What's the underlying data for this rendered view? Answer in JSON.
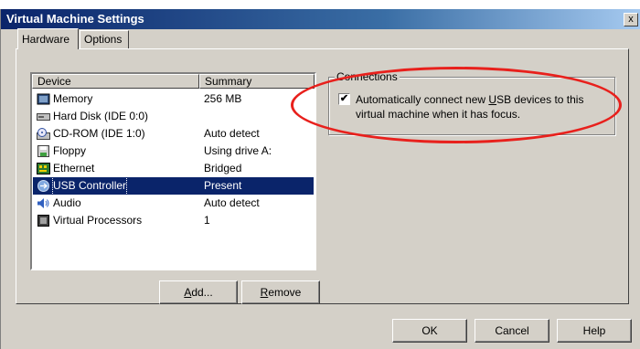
{
  "window": {
    "title": "Virtual Machine Settings",
    "close_glyph": "x"
  },
  "tabs": [
    {
      "label": "Hardware"
    },
    {
      "label": "Options"
    }
  ],
  "device_list": {
    "headers": {
      "device": "Device",
      "summary": "Summary"
    },
    "rows": [
      {
        "device": "Memory",
        "summary": "256 MB",
        "icon": "memory-icon"
      },
      {
        "device": "Hard Disk (IDE 0:0)",
        "summary": "",
        "icon": "hard-disk-icon"
      },
      {
        "device": "CD-ROM (IDE 1:0)",
        "summary": "Auto detect",
        "icon": "cdrom-icon"
      },
      {
        "device": "Floppy",
        "summary": "Using drive A:",
        "icon": "floppy-icon"
      },
      {
        "device": "Ethernet",
        "summary": "Bridged",
        "icon": "ethernet-icon"
      },
      {
        "device": "USB Controller",
        "summary": "Present",
        "icon": "usb-icon",
        "selected": true
      },
      {
        "device": "Audio",
        "summary": "Auto detect",
        "icon": "audio-icon"
      },
      {
        "device": "Virtual Processors",
        "summary": "1",
        "icon": "processor-icon"
      }
    ]
  },
  "buttons": {
    "add": {
      "prefix": "",
      "accel": "A",
      "suffix": "dd..."
    },
    "remove": {
      "prefix": "",
      "accel": "R",
      "suffix": "emove"
    },
    "ok": "OK",
    "cancel": "Cancel",
    "help": "Help"
  },
  "connections": {
    "label": "Connections",
    "checkbox_checked": true,
    "option_line1_prefix": "Automatically connect new ",
    "option_line1_accel": "U",
    "option_line1_suffix": "SB devices to this",
    "option_line2": "virtual machine when it has focus."
  },
  "colors": {
    "selection": "#0a246a",
    "annotation_ellipse": "#e8201c",
    "dialog_face": "#d4d0c8"
  }
}
